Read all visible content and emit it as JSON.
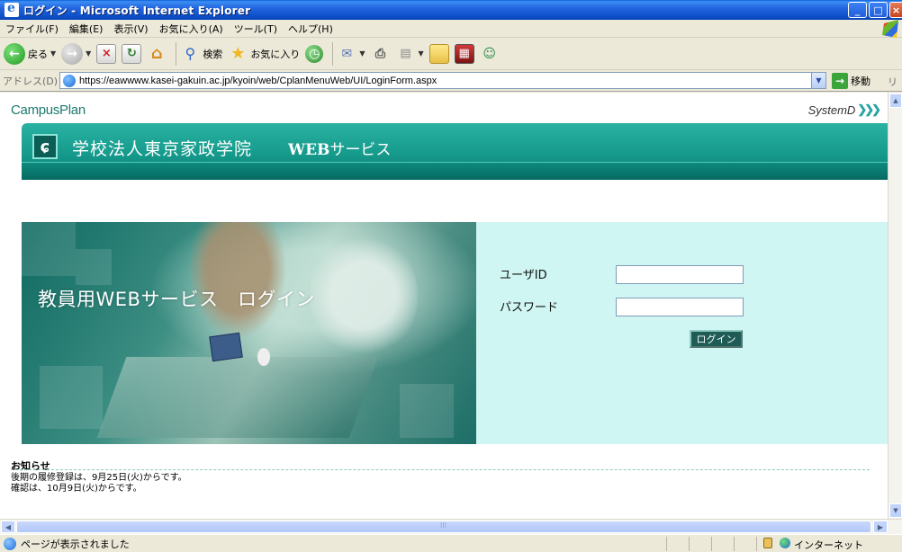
{
  "window": {
    "title": "ログイン - Microsoft Internet Explorer",
    "minimize": "_",
    "maximize": "□",
    "close": "×"
  },
  "menu": {
    "items": [
      "ファイル(F)",
      "編集(E)",
      "表示(V)",
      "お気に入り(A)",
      "ツール(T)",
      "ヘルプ(H)"
    ]
  },
  "toolbar": {
    "back_label": "戻る",
    "search_label": "検索",
    "favorites_label": "お気に入り"
  },
  "address": {
    "label": "アドレス(D)",
    "url": "https://eawwww.kasei-gakuin.ac.jp/kyoin/web/CplanMenuWeb/UI/LoginForm.aspx",
    "go_label": "移動",
    "links_label": "リン"
  },
  "page": {
    "brand_left": "CampusPlan",
    "brand_right": "SystemD",
    "school_name": "学校法人東京家政学院",
    "service_prefix": "WEB",
    "service_suffix": "サービス",
    "hero_title": "教員用WEBサービス　ログイン",
    "login": {
      "user_label": "ユーザID",
      "password_label": "パスワード",
      "user_value": "",
      "password_value": "",
      "button_label": "ログイン"
    },
    "notice": {
      "title": "お知らせ",
      "lines": [
        "後期の履修登録は、9月25日(火)からです。",
        "確認は、10月9日(火)からです。"
      ]
    }
  },
  "status": {
    "text": "ページが表示されました",
    "zone": "インターネット"
  },
  "colors": {
    "teal_band": "#159A8C",
    "login_panel": "#CFF6F2",
    "xp_title": "#0A4BC4"
  }
}
